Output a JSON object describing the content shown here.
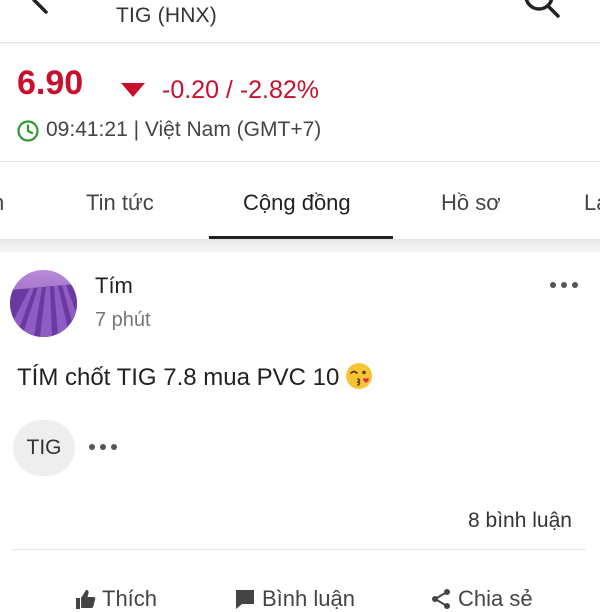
{
  "header": {
    "title": "TIG (HNX)",
    "back_icon": "back-arrow-icon",
    "search_icon": "search-icon"
  },
  "quote": {
    "price": "6.90",
    "change": "-0.20 / -2.82%",
    "direction_icon": "down-triangle-icon",
    "timestamp": "09:41:21 | Việt Nam (GMT+7)",
    "clock_icon": "clock-icon"
  },
  "tabs": [
    {
      "label": "n"
    },
    {
      "label": "Tin tức"
    },
    {
      "label": "Cộng đồng",
      "active": true
    },
    {
      "label": "Hồ sơ"
    },
    {
      "label": "La"
    }
  ],
  "post": {
    "author": "Tím",
    "time": "7 phút",
    "text": "TÍM chốt TIG 7.8 mua PVC 10",
    "emoji": "kissing-face-emoji",
    "tag": "TIG",
    "comments": "8 bình luận"
  },
  "actions": [
    {
      "label": "Thích",
      "icon": "thumbs-up-icon"
    },
    {
      "label": "Bình luận",
      "icon": "comment-icon"
    },
    {
      "label": "Chia sẻ",
      "icon": "share-icon"
    }
  ],
  "colors": {
    "price_down": "#c8102e",
    "avatar_purple": "#6b3fa0",
    "text": "#222222",
    "muted": "#777777"
  }
}
